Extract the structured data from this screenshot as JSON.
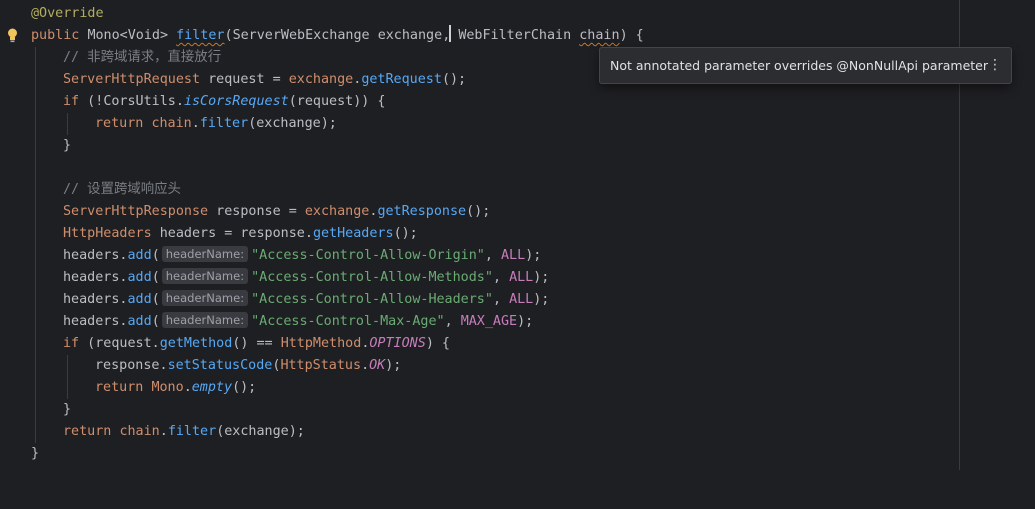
{
  "editor": {
    "tooltip": {
      "message": "Not annotated parameter overrides @NonNullApi parameter",
      "more_icon": "⋮"
    },
    "hints": {
      "header_name": "headerName:"
    },
    "colors": {
      "background": "#1e1f22",
      "keyword": "#cf8e6d",
      "method": "#56a8f5",
      "string": "#6aab73",
      "comment": "#7a7e85",
      "annotation": "#b3ae60",
      "constant": "#c77dbb",
      "warning_underline": "#c3792e"
    },
    "lines": {
      "l1": {
        "annotation": "@Override"
      },
      "l2": {
        "kw": "public",
        "ret": "Mono<Void>",
        "name": "filter",
        "open": "(",
        "type1": "ServerWebExchange",
        "param1": "exchange",
        "comma": ",",
        "type2": "WebFilterChain",
        "param2": "chain",
        "close": ") {"
      },
      "l3": {
        "comment": "// 非跨域请求，直接放行"
      },
      "l4": {
        "type": "ServerHttpRequest",
        "var": " request = ",
        "obj": "exchange",
        "dot": ".",
        "call": "getRequest",
        "tail": "();"
      },
      "l5": {
        "kw": "if",
        "p1": " (!",
        "cls": "CorsUtils",
        "dot": ".",
        "call": "isCorsRequest",
        "tail": "(request)) {"
      },
      "l6": {
        "kw": "return",
        "sp": " ",
        "obj": "chain",
        "dot": ".",
        "call": "filter",
        "tail": "(exchange);"
      },
      "l7": {
        "text": "}"
      },
      "l9": {
        "comment": "// 设置跨域响应头"
      },
      "l10": {
        "type": "ServerHttpResponse",
        "var": " response = ",
        "obj": "exchange",
        "dot": ".",
        "call": "getResponse",
        "tail": "();"
      },
      "l11": {
        "type": "HttpHeaders",
        "var": " headers = response.",
        "call": "getHeaders",
        "tail": "();"
      },
      "l12": {
        "pre": "headers.",
        "call": "add",
        "open": "(",
        "str": "\"Access-Control-Allow-Origin\"",
        "sep": ", ",
        "const": "ALL",
        "tail": ");"
      },
      "l13": {
        "pre": "headers.",
        "call": "add",
        "open": "(",
        "str": "\"Access-Control-Allow-Methods\"",
        "sep": ", ",
        "const": "ALL",
        "tail": ");"
      },
      "l14": {
        "pre": "headers.",
        "call": "add",
        "open": "(",
        "str": "\"Access-Control-Allow-Headers\"",
        "sep": ", ",
        "const": "ALL",
        "tail": ");"
      },
      "l15": {
        "pre": "headers.",
        "call": "add",
        "open": "(",
        "str": "\"Access-Control-Max-Age\"",
        "sep": ", ",
        "const": "MAX_AGE",
        "tail": ");"
      },
      "l16": {
        "kw": "if",
        "p1": " (request.",
        "call": "getMethod",
        "p2": "() == ",
        "cls": "HttpMethod",
        "dot": ".",
        "const": "OPTIONS",
        "tail": ") {"
      },
      "l17": {
        "pre": "response.",
        "call": "setStatusCode",
        "p1": "(",
        "cls": "HttpStatus",
        "dot": ".",
        "const": "OK",
        "tail": ");"
      },
      "l18": {
        "kw": "return",
        "sp": " ",
        "cls": "Mono",
        "dot": ".",
        "call": "empty",
        "tail": "();"
      },
      "l19": {
        "text": "}"
      },
      "l20": {
        "kw": "return",
        "sp": " ",
        "obj": "chain",
        "dot": ".",
        "call": "filter",
        "tail": "(exchange);"
      },
      "l21": {
        "text": "}"
      }
    }
  }
}
